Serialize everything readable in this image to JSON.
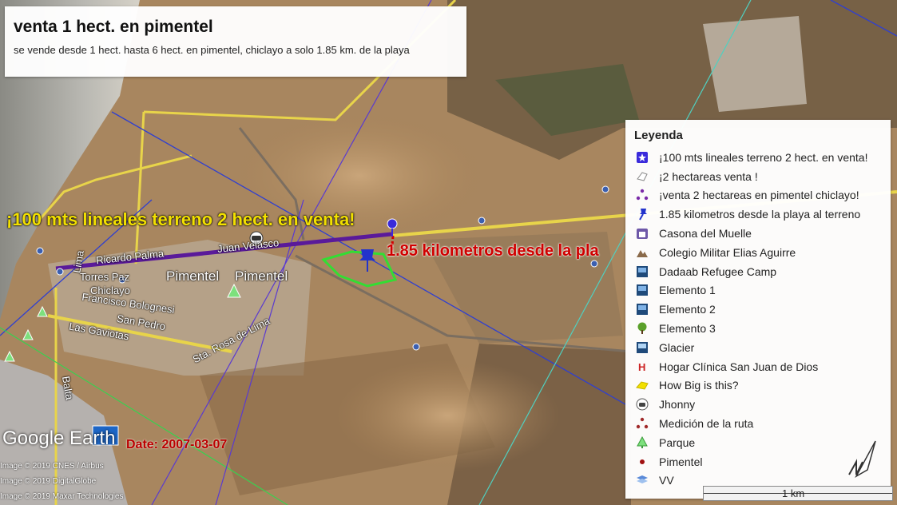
{
  "title_box": {
    "title": "venta 1 hect. en pimentel",
    "subtitle": "se vende desde 1 hect. hasta 6 hect. en pimentel, chiclayo a solo 1.85 km. de la playa"
  },
  "map_labels": {
    "headline": "¡100 mts lineales terreno 2 hect. en venta!",
    "distance": "1.85 kilometros desde la pla",
    "pimentel_1": "Pimentel",
    "pimentel_2": "Pimentel",
    "date": "Date: 2007-03-07",
    "google_earth": "Google Earth"
  },
  "streets": [
    "Ricardo Palma",
    "Juan Velasco",
    "Torres Paz",
    "Chiclayo",
    "Francisco Bolognesi",
    "San Pedro",
    "Las Gaviotas",
    "Sta. Rosa de Lima",
    "Lima",
    "Balta"
  ],
  "credits": [
    "Image © 2019 CNES / Airbus",
    "Image © 2019 DigitalGlobe",
    "Image © 2019 Maxar Technologies"
  ],
  "legend": {
    "title": "Leyenda",
    "items": [
      {
        "label": "¡100 mts lineales terreno 2 hect. en venta!",
        "icon": "star-marker-icon"
      },
      {
        "label": "¡2 hectareas venta !",
        "icon": "polygon-icon"
      },
      {
        "label": "¡venta 2 hectareas en pimentel chiclayo!",
        "icon": "path-nodes-icon"
      },
      {
        "label": "1.85 kilometros desde la playa al terreno",
        "icon": "blue-pushpin-icon"
      },
      {
        "label": "Casona del Muelle",
        "icon": "museum-icon"
      },
      {
        "label": "Colegio Militar Elias Aguirre",
        "icon": "terrain-icon"
      },
      {
        "label": "Dadaab Refugee Camp",
        "icon": "photo-icon"
      },
      {
        "label": "Elemento 1",
        "icon": "photo-icon"
      },
      {
        "label": "Elemento 2",
        "icon": "photo-icon"
      },
      {
        "label": "Elemento 3",
        "icon": "tree-icon"
      },
      {
        "label": "Glacier",
        "icon": "photo-icon"
      },
      {
        "label": "Hogar Clínica San Juan de Dios",
        "icon": "hospital-icon"
      },
      {
        "label": "How Big is this?",
        "icon": "yellow-shape-icon"
      },
      {
        "label": "Jhonny",
        "icon": "car-icon"
      },
      {
        "label": "Medición de la ruta",
        "icon": "route-nodes-icon"
      },
      {
        "label": "Parque",
        "icon": "park-tree-icon"
      },
      {
        "label": "Pimentel",
        "icon": "red-dot-icon"
      },
      {
        "label": "VV",
        "icon": "map-icon"
      }
    ]
  },
  "scale": {
    "label": "1 km"
  },
  "colors": {
    "headline_text": "#f2e000",
    "distance_text": "#d00000",
    "boundary_green": "#33dd33",
    "route_purple": "#5a1a9a",
    "road_yellow": "#e8d44a",
    "pushpin_blue": "#2233cc"
  }
}
